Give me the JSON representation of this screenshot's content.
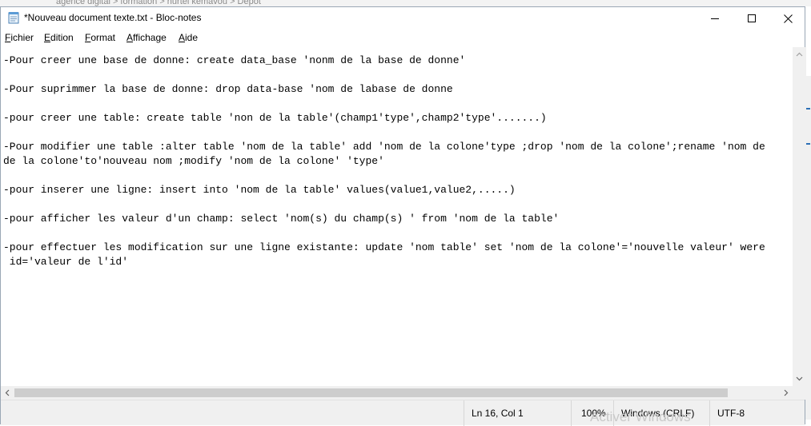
{
  "background": {
    "breadcrumbs": "agence digital  >  formation  >  hurtel kemavou  >  Dépôt"
  },
  "window": {
    "title": "*Nouveau document texte.txt - Bloc-notes"
  },
  "menu": {
    "items": [
      {
        "underline": "F",
        "rest": "ichier"
      },
      {
        "underline": "E",
        "rest": "dition"
      },
      {
        "underline": "F",
        "rest": "ormat"
      },
      {
        "underline": "A",
        "rest": "ffichage"
      },
      {
        "underline": "A",
        "rest": "ide"
      }
    ]
  },
  "editor": {
    "lines": [
      "-Pour creer une base de donne: create data_base 'nonm de la base de donne'",
      "",
      "-Pour suprimmer la base de donne: drop data-base 'nom de labase de donne",
      "",
      "-pour creer une table: create table 'non de la table'(champ1'type',champ2'type'.......)",
      "",
      "-Pour modifier une table :alter table 'nom de la table' add 'nom de la colone'type ;drop 'nom de la colone';rename 'nom de",
      "de la colone'to'nouveau nom ;modify 'nom de la colone' 'type'",
      "",
      "-pour inserer une ligne: insert into 'nom de la table' values(value1,value2,.....)",
      "",
      "-pour afficher les valeur d'un champ: select 'nom(s) du champ(s) ' from 'nom de la table'",
      "",
      "-pour effectuer les modification sur une ligne existante: update 'nom table' set 'nom de la colone'='nouvelle valeur' were",
      " id='valeur de l'id'"
    ]
  },
  "status": {
    "position": "Ln 16, Col 1",
    "zoom": "100%",
    "line_ending": "Windows (CRLF)",
    "encoding": "UTF-8"
  },
  "watermark": "Activer Windows",
  "icons": {
    "app": "notepad-icon",
    "minimize": "minimize-icon",
    "maximize": "maximize-icon",
    "close": "close-icon"
  }
}
